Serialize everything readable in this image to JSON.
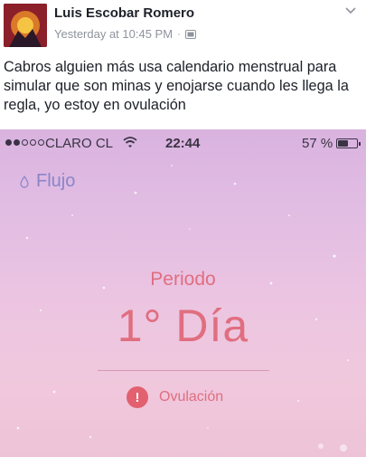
{
  "post": {
    "author": "Luis Escobar Romero",
    "timestamp": "Yesterday at 10:45 PM",
    "separator": "·",
    "privacy_icon": "globe-icon",
    "menu_icon": "chevron-down-icon",
    "text": "Cabros alguien más usa calendario menstrual para simular que son minas y enojarse cuando les llega la regla, yo estoy en ovulación"
  },
  "phone": {
    "status_bar": {
      "carrier": "CLARO CL",
      "time": "22:44",
      "battery": "57 %",
      "battery_level": 0.57,
      "signal_bars": 2,
      "signal_total": 5
    },
    "flow_label": "Flujo",
    "period_label": "Periodo",
    "day_label": "1° Día",
    "ovulation_label": "Ovulación",
    "alert_symbol": "!"
  },
  "colors": {
    "accent_pink": "#e06e7f",
    "accent_purple": "#8a85c9",
    "background_top": "#d9b3df",
    "background_bottom": "#eec3d7"
  }
}
